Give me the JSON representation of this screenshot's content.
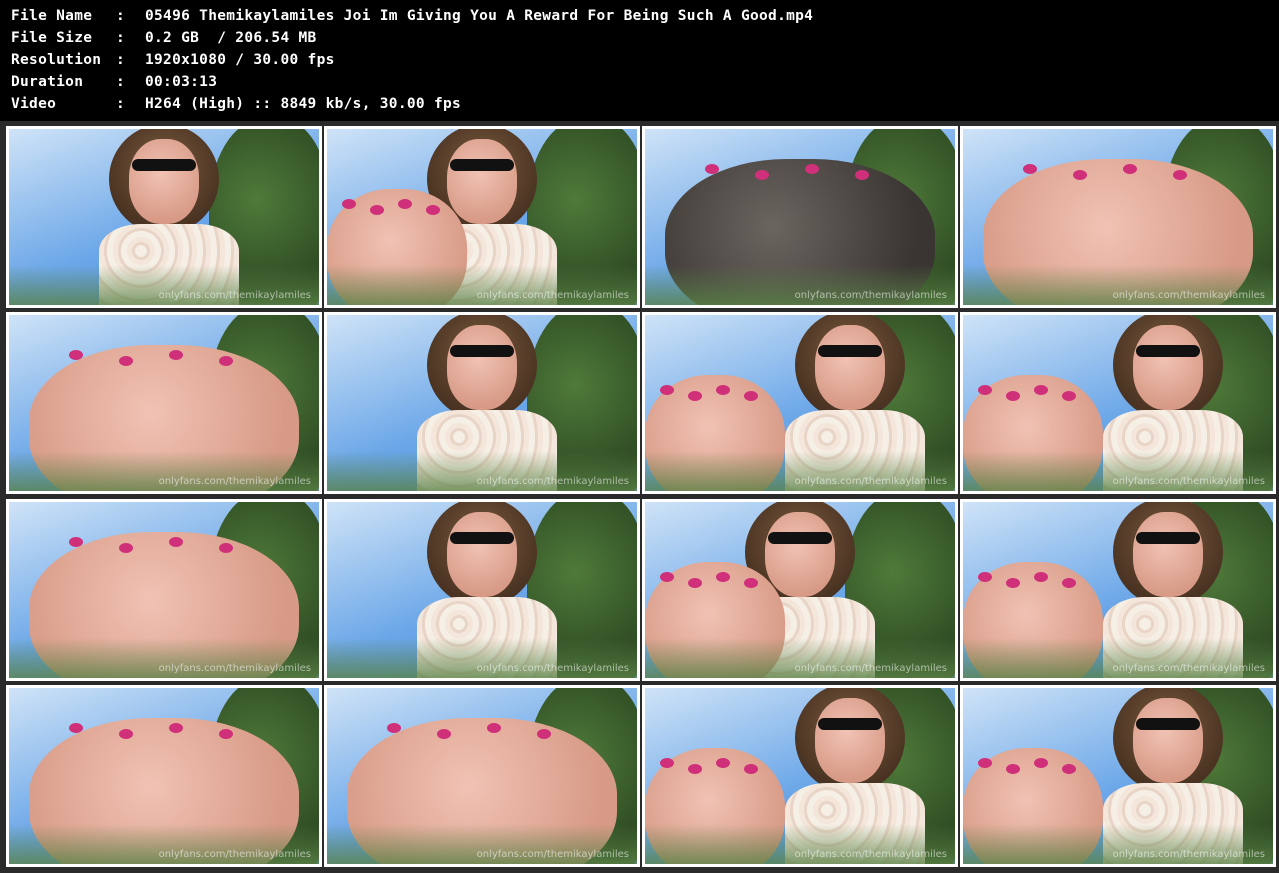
{
  "info": {
    "file_name": {
      "key": "File Name",
      "colon": ":",
      "value": "05496 Themikaylamiles Joi Im Giving You A Reward For Being Such A Good.mp4"
    },
    "file_size": {
      "key": "File Size",
      "colon": ":",
      "value": "0.2 GB  / 206.54 MB"
    },
    "resolution": {
      "key": "Resolution",
      "colon": ":",
      "value": "1920x1080 / 30.00 fps"
    },
    "duration": {
      "key": "Duration",
      "colon": ":",
      "value": "00:03:13"
    },
    "video": {
      "key": "Video",
      "colon": ":",
      "value": "H264 (High) :: 8849 kb/s, 30.00 fps"
    }
  },
  "watermark": "onlyfans.com/themikaylamiles",
  "thumbnails": [
    {
      "scene": "face"
    },
    {
      "scene": "face-hand"
    },
    {
      "scene": "sole-closeup"
    },
    {
      "scene": "toes"
    },
    {
      "scene": "toes"
    },
    {
      "scene": "face"
    },
    {
      "scene": "toes-face"
    },
    {
      "scene": "toe-face"
    },
    {
      "scene": "toes"
    },
    {
      "scene": "face"
    },
    {
      "scene": "face-hand"
    },
    {
      "scene": "toe-face"
    },
    {
      "scene": "toes"
    },
    {
      "scene": "toes"
    },
    {
      "scene": "toe-face"
    },
    {
      "scene": "toes-face"
    }
  ],
  "colors": {
    "sky": "#6aa6e8",
    "sky_light": "#cfe3f7",
    "header_bg": "#000000",
    "border": "#ffffff"
  }
}
